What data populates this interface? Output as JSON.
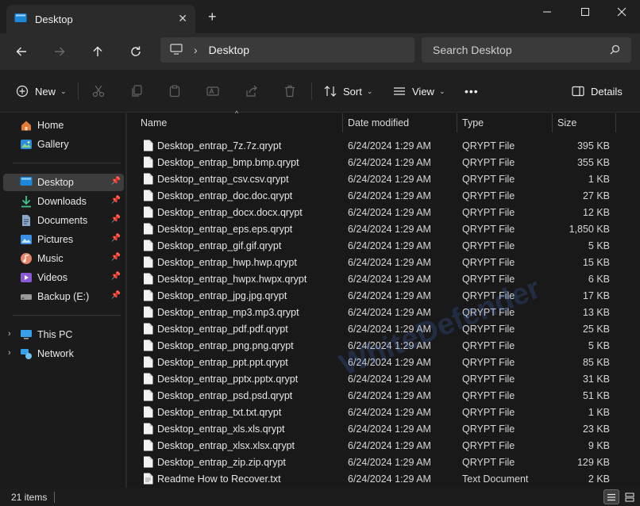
{
  "window": {
    "tab_title": "Desktop",
    "new_tab_icon": "+",
    "close_tab_icon": "✕"
  },
  "address": {
    "location": "Desktop",
    "search_placeholder": "Search Desktop"
  },
  "toolbar": {
    "new_label": "New",
    "sort_label": "Sort",
    "view_label": "View",
    "more_label": "•••",
    "details_label": "Details"
  },
  "sidebar": {
    "items": [
      {
        "label": "Home",
        "icon": "home-icon"
      },
      {
        "label": "Gallery",
        "icon": "gallery-icon"
      },
      {
        "label": "Desktop",
        "icon": "desktop-icon",
        "pinned": true,
        "selected": true
      },
      {
        "label": "Downloads",
        "icon": "downloads-icon",
        "pinned": true
      },
      {
        "label": "Documents",
        "icon": "documents-icon",
        "pinned": true
      },
      {
        "label": "Pictures",
        "icon": "pictures-icon",
        "pinned": true
      },
      {
        "label": "Music",
        "icon": "music-icon",
        "pinned": true
      },
      {
        "label": "Videos",
        "icon": "videos-icon",
        "pinned": true
      },
      {
        "label": "Backup (E:)",
        "icon": "drive-icon",
        "pinned": true
      },
      {
        "label": "This PC",
        "icon": "this-pc-icon"
      },
      {
        "label": "Network",
        "icon": "network-icon"
      }
    ]
  },
  "columns": {
    "name": "Name",
    "date": "Date modified",
    "type": "Type",
    "size": "Size"
  },
  "files": [
    {
      "name": "Desktop_entrap_7z.7z.qrypt",
      "date": "6/24/2024 1:29 AM",
      "type": "QRYPT File",
      "size": "395 KB"
    },
    {
      "name": "Desktop_entrap_bmp.bmp.qrypt",
      "date": "6/24/2024 1:29 AM",
      "type": "QRYPT File",
      "size": "355 KB"
    },
    {
      "name": "Desktop_entrap_csv.csv.qrypt",
      "date": "6/24/2024 1:29 AM",
      "type": "QRYPT File",
      "size": "1 KB"
    },
    {
      "name": "Desktop_entrap_doc.doc.qrypt",
      "date": "6/24/2024 1:29 AM",
      "type": "QRYPT File",
      "size": "27 KB"
    },
    {
      "name": "Desktop_entrap_docx.docx.qrypt",
      "date": "6/24/2024 1:29 AM",
      "type": "QRYPT File",
      "size": "12 KB"
    },
    {
      "name": "Desktop_entrap_eps.eps.qrypt",
      "date": "6/24/2024 1:29 AM",
      "type": "QRYPT File",
      "size": "1,850 KB"
    },
    {
      "name": "Desktop_entrap_gif.gif.qrypt",
      "date": "6/24/2024 1:29 AM",
      "type": "QRYPT File",
      "size": "5 KB"
    },
    {
      "name": "Desktop_entrap_hwp.hwp.qrypt",
      "date": "6/24/2024 1:29 AM",
      "type": "QRYPT File",
      "size": "15 KB"
    },
    {
      "name": "Desktop_entrap_hwpx.hwpx.qrypt",
      "date": "6/24/2024 1:29 AM",
      "type": "QRYPT File",
      "size": "6 KB"
    },
    {
      "name": "Desktop_entrap_jpg.jpg.qrypt",
      "date": "6/24/2024 1:29 AM",
      "type": "QRYPT File",
      "size": "17 KB"
    },
    {
      "name": "Desktop_entrap_mp3.mp3.qrypt",
      "date": "6/24/2024 1:29 AM",
      "type": "QRYPT File",
      "size": "13 KB"
    },
    {
      "name": "Desktop_entrap_pdf.pdf.qrypt",
      "date": "6/24/2024 1:29 AM",
      "type": "QRYPT File",
      "size": "25 KB"
    },
    {
      "name": "Desktop_entrap_png.png.qrypt",
      "date": "6/24/2024 1:29 AM",
      "type": "QRYPT File",
      "size": "5 KB"
    },
    {
      "name": "Desktop_entrap_ppt.ppt.qrypt",
      "date": "6/24/2024 1:29 AM",
      "type": "QRYPT File",
      "size": "85 KB"
    },
    {
      "name": "Desktop_entrap_pptx.pptx.qrypt",
      "date": "6/24/2024 1:29 AM",
      "type": "QRYPT File",
      "size": "31 KB"
    },
    {
      "name": "Desktop_entrap_psd.psd.qrypt",
      "date": "6/24/2024 1:29 AM",
      "type": "QRYPT File",
      "size": "51 KB"
    },
    {
      "name": "Desktop_entrap_txt.txt.qrypt",
      "date": "6/24/2024 1:29 AM",
      "type": "QRYPT File",
      "size": "1 KB"
    },
    {
      "name": "Desktop_entrap_xls.xls.qrypt",
      "date": "6/24/2024 1:29 AM",
      "type": "QRYPT File",
      "size": "23 KB"
    },
    {
      "name": "Desktop_entrap_xlsx.xlsx.qrypt",
      "date": "6/24/2024 1:29 AM",
      "type": "QRYPT File",
      "size": "9 KB"
    },
    {
      "name": "Desktop_entrap_zip.zip.qrypt",
      "date": "6/24/2024 1:29 AM",
      "type": "QRYPT File",
      "size": "129 KB"
    },
    {
      "name": "Readme How to Recover.txt",
      "date": "6/24/2024 1:29 AM",
      "type": "Text Document",
      "size": "2 KB"
    }
  ],
  "watermark": "WhiteDefender",
  "status": {
    "item_count": "21 items"
  },
  "colors": {
    "background": "#191919",
    "selected": "#3d3d3d",
    "accent": "#4aa3e8"
  }
}
